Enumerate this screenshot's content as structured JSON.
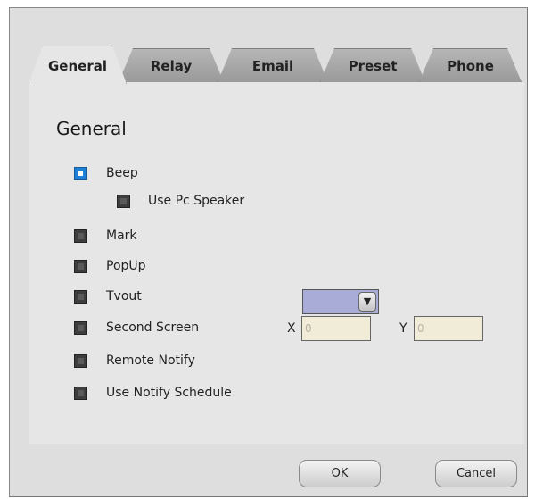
{
  "tabs": [
    {
      "label": "General",
      "active": true
    },
    {
      "label": "Relay",
      "active": false
    },
    {
      "label": "Email",
      "active": false
    },
    {
      "label": "Preset",
      "active": false
    },
    {
      "label": "Phone",
      "active": false
    }
  ],
  "panel": {
    "title": "General",
    "options": {
      "beep": {
        "label": "Beep",
        "checked": true
      },
      "use_pc_speaker": {
        "label": "Use Pc Speaker",
        "checked": false
      },
      "mark": {
        "label": "Mark",
        "checked": false
      },
      "popup": {
        "label": "PopUp",
        "checked": false
      },
      "tvout": {
        "label": "Tvout",
        "checked": false
      },
      "second_screen": {
        "label": "Second Screen",
        "checked": false
      },
      "remote_notify": {
        "label": "Remote Notify",
        "checked": false
      },
      "use_notify_schedule": {
        "label": "Use Notify Schedule",
        "checked": false
      }
    },
    "tvout_select": {
      "value": ""
    },
    "second_screen_x": {
      "label": "X",
      "value": "0"
    },
    "second_screen_y": {
      "label": "Y",
      "value": "0"
    }
  },
  "buttons": {
    "ok": "OK",
    "cancel": "Cancel"
  },
  "colors": {
    "checked": "#1f7fd6",
    "select_bg": "#a9acd6",
    "field_bg": "#f1ecd8"
  }
}
